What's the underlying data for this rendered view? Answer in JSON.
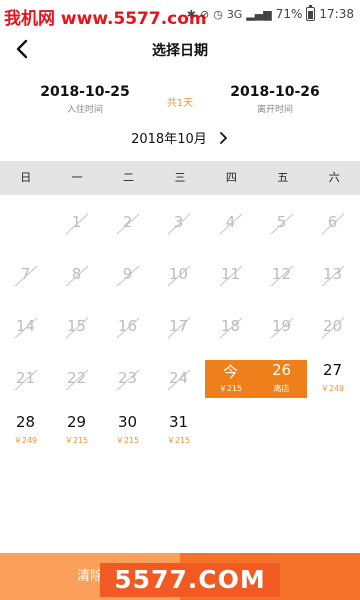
{
  "status_bar": {
    "watermark": "我机网 www.5577.com",
    "signal": "3G",
    "battery_percent": "71%",
    "time": "17:38"
  },
  "header": {
    "title": "选择日期"
  },
  "stay": {
    "checkin_date": "2018-10-25",
    "checkin_label": "入住时间",
    "nights_label": "共1天",
    "checkout_date": "2018-10-26",
    "checkout_label": "离开时间"
  },
  "month": {
    "label": "2018年10月"
  },
  "weekdays": [
    "日",
    "一",
    "二",
    "三",
    "四",
    "五",
    "六"
  ],
  "calendar": {
    "disabled_days": [
      "1",
      "2",
      "3",
      "4",
      "5",
      "6",
      "7",
      "8",
      "9",
      "10",
      "11",
      "12",
      "13",
      "14",
      "15",
      "16",
      "17",
      "18",
      "19",
      "20",
      "21",
      "22",
      "23",
      "24"
    ],
    "checkin_day": {
      "label": "今",
      "price": "￥215"
    },
    "checkout_day": {
      "label": "26",
      "sub": "离店"
    },
    "available_days": [
      {
        "day": "27",
        "price": "￥249"
      },
      {
        "day": "28",
        "price": "￥249"
      },
      {
        "day": "29",
        "price": "￥215"
      },
      {
        "day": "30",
        "price": "￥215"
      },
      {
        "day": "31",
        "price": "￥215"
      }
    ]
  },
  "footer": {
    "clear_label": "清除",
    "confirm_label": "",
    "watermark_logo": "5577.COM"
  },
  "colors": {
    "accent": "#ef7f1a",
    "price": "#f39533",
    "disabled": "#bdbdbd",
    "weekday_bg": "#e4e4e4"
  }
}
